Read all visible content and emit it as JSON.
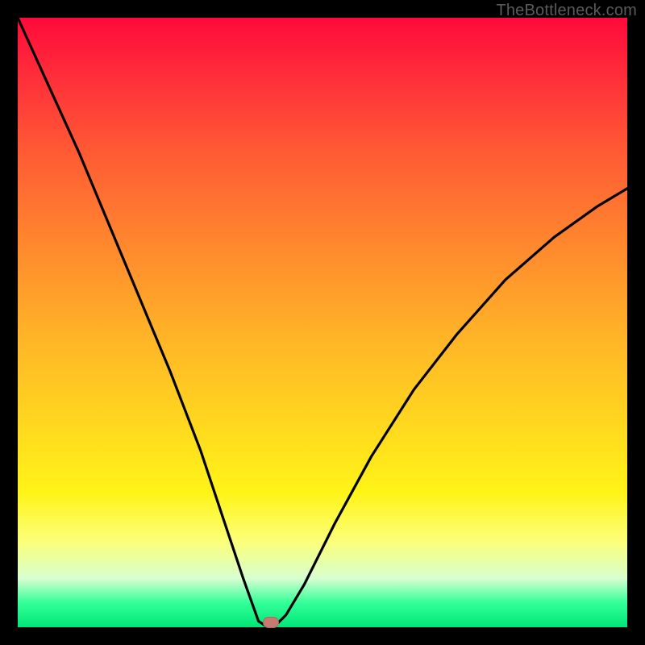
{
  "watermark": "TheBottleneck.com",
  "marker": {
    "x_frac": 0.415,
    "y_frac": 0.992
  },
  "chart_data": {
    "type": "line",
    "title": "",
    "xlabel": "",
    "ylabel": "",
    "xlim": [
      0,
      1
    ],
    "ylim": [
      0,
      1
    ],
    "grid": false,
    "series": [
      {
        "name": "bottleneck-curve",
        "x": [
          0.0,
          0.05,
          0.1,
          0.15,
          0.2,
          0.25,
          0.3,
          0.34,
          0.37,
          0.395,
          0.41,
          0.42,
          0.44,
          0.47,
          0.52,
          0.58,
          0.65,
          0.72,
          0.8,
          0.88,
          0.95,
          1.0
        ],
        "y": [
          1.0,
          0.89,
          0.78,
          0.66,
          0.54,
          0.42,
          0.29,
          0.17,
          0.08,
          0.01,
          0.0,
          0.0,
          0.02,
          0.07,
          0.17,
          0.28,
          0.39,
          0.48,
          0.57,
          0.64,
          0.69,
          0.72
        ]
      }
    ],
    "background_gradient": {
      "type": "vertical",
      "stops": [
        {
          "pos": 0.0,
          "color": "#ff0a3a"
        },
        {
          "pos": 0.5,
          "color": "#ffb327"
        },
        {
          "pos": 0.8,
          "color": "#fff418"
        },
        {
          "pos": 1.0,
          "color": "#00e676"
        }
      ]
    },
    "marker": {
      "x": 0.415,
      "y": 0.008,
      "color": "#c97a70",
      "shape": "pill"
    }
  }
}
